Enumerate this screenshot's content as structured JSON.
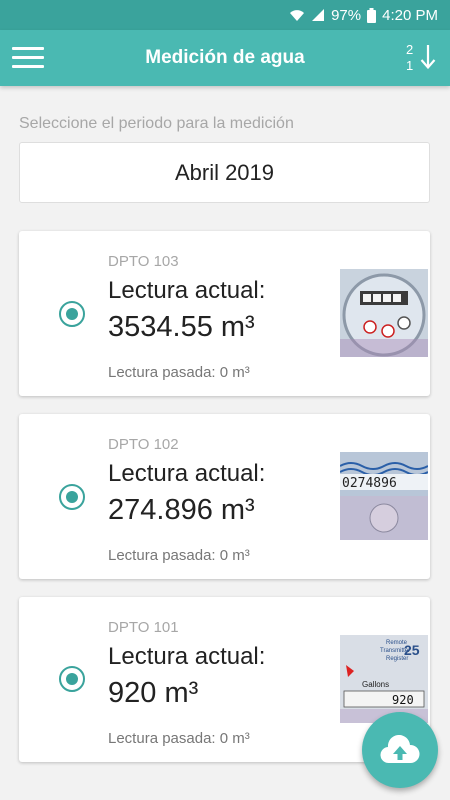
{
  "status_bar": {
    "battery": "97%",
    "time": "4:20 PM"
  },
  "app_bar": {
    "title": "Medición de agua",
    "sort_top": "2",
    "sort_bottom": "1"
  },
  "period": {
    "label": "Seleccione el periodo para la medición",
    "value": "Abril 2019"
  },
  "readings": [
    {
      "dept": "DPTO 103",
      "label": "Lectura actual:",
      "value": "3534.55 m³",
      "previous": "Lectura pasada: 0 m³",
      "meter_image": "meter-dial-photo"
    },
    {
      "dept": "DPTO 102",
      "label": "Lectura actual:",
      "value": "274.896 m³",
      "previous": "Lectura pasada: 0 m³",
      "meter_image": "meter-digits-photo",
      "meter_digits": "0274896"
    },
    {
      "dept": "DPTO 101",
      "label": "Lectura actual:",
      "value": "920 m³",
      "previous": "Lectura pasada: 0 m³",
      "meter_image": "meter-gallons-photo",
      "meter_text": [
        "Remote",
        "Transmitter",
        "Register",
        "25",
        "Gallons",
        "920"
      ]
    }
  ],
  "colors": {
    "primary": "#4ab9b2",
    "primary_dark": "#3aa39c",
    "accent": "#3aa39c"
  },
  "icons": {
    "menu": "hamburger-icon",
    "sort": "sort-numeric-icon",
    "upload": "cloud-upload-icon",
    "wifi": "wifi-icon",
    "signal": "signal-icon",
    "battery": "battery-icon"
  }
}
